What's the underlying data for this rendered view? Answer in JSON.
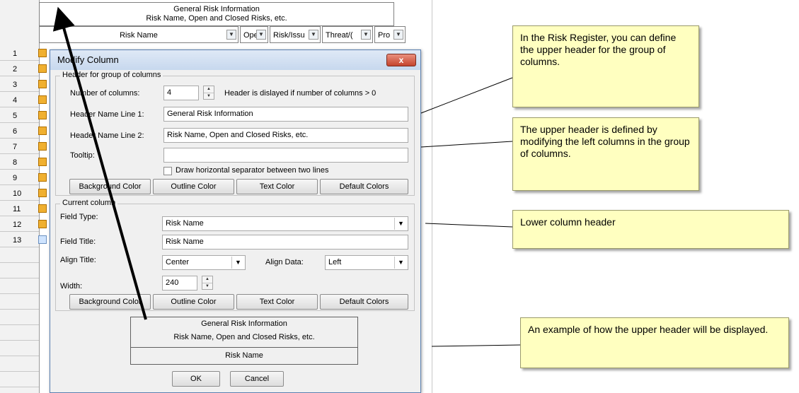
{
  "grid": {
    "group_header_line1": "General Risk Information",
    "group_header_line2": "Risk Name, Open and Closed Risks, etc.",
    "columns": [
      "Risk Name",
      "Ope",
      "Risk/Issu",
      "Threat/(",
      "Pro"
    ],
    "row_numbers": [
      "1",
      "2",
      "3",
      "4",
      "5",
      "6",
      "7",
      "8",
      "9",
      "10",
      "11",
      "12",
      "13"
    ]
  },
  "dialog": {
    "title": "Modify Column",
    "close_label": "x",
    "group1": {
      "legend": "Header for group of columns",
      "num_columns_label": "Number of columns:",
      "num_columns_value": "4",
      "num_columns_hint": "Header is dislayed if number of columns > 0",
      "line1_label": "Header Name Line 1:",
      "line1_value": "General Risk Information",
      "line2_label": "Header Name Line 2:",
      "line2_value": "Risk Name, Open and Closed Risks, etc.",
      "tooltip_label": "Tooltip:",
      "tooltip_value": "",
      "separator_label": "Draw horizontal separator between two lines",
      "buttons": [
        "Background Color",
        "Outline Color",
        "Text Color",
        "Default Colors"
      ]
    },
    "group2": {
      "legend": "Current column",
      "field_type_label": "Field Type:",
      "field_type_value": "Risk Name",
      "field_title_label": "Field Title:",
      "field_title_value": "Risk Name",
      "align_title_label": "Align Title:",
      "align_title_value": "Center",
      "align_data_label": "Align Data:",
      "align_data_value": "Left",
      "width_label": "Width:",
      "width_value": "240",
      "buttons": [
        "Background Color",
        "Outline Color",
        "Text Color",
        "Default Colors"
      ]
    },
    "preview": {
      "line1": "General Risk Information",
      "line2": "Risk Name, Open and Closed Risks, etc.",
      "line3": "Risk Name"
    },
    "ok_label": "OK",
    "cancel_label": "Cancel"
  },
  "callouts": {
    "c1": "In the Risk Register, you can define the upper header for the group of columns.",
    "c2": "The upper header is defined by modifying the left columns in the group of columns.",
    "c3": "Lower column header",
    "c4": "An example of how the upper header will be displayed."
  },
  "colors": {
    "callout_bg": "#ffffc0",
    "dialog_bg": "#f0f0f0",
    "close_button": "#c5442e",
    "row_icon": "#f0b030"
  }
}
